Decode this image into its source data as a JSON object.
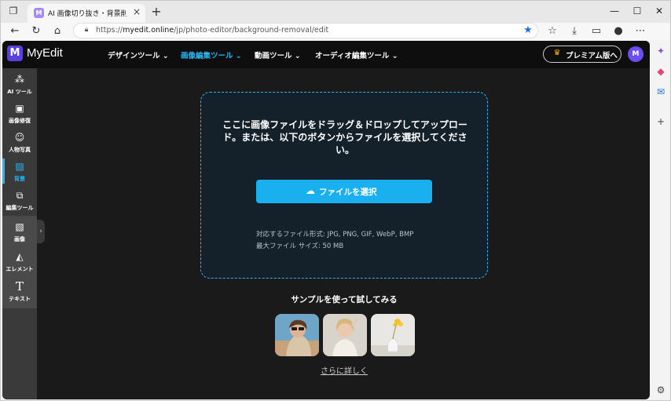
{
  "browser": {
    "tab_title": "AI 画像切り抜き・背景削除サイト | M",
    "favicon_letter": "M",
    "url_prefix": "https://",
    "url_host": "myedit.online",
    "url_path": "/jp/photo-editor/background-removal/edit"
  },
  "header": {
    "logo_mark": "M",
    "logo_text": "MyEdit",
    "menus": [
      {
        "label": "デザインツール ⌄"
      },
      {
        "label": "画像編集ツール ⌄"
      },
      {
        "label": "動画ツール ⌄"
      },
      {
        "label": "オーディオ編集ツール ⌄"
      }
    ],
    "premium_label": "プレミアム版へ",
    "avatar_letter": "M"
  },
  "sidebar": {
    "items": [
      {
        "label": "AI ツール",
        "icon": "magic-wand-icon"
      },
      {
        "label": "画像修復",
        "icon": "image-repair-icon"
      },
      {
        "label": "人物写真",
        "icon": "portrait-icon"
      },
      {
        "label": "背景",
        "icon": "background-icon"
      },
      {
        "label": "編集ツール",
        "icon": "edit-tools-icon"
      },
      {
        "label": "画像",
        "icon": "image-icon"
      },
      {
        "label": "エレメント",
        "icon": "elements-icon"
      },
      {
        "label": "テキスト",
        "icon": "text-icon"
      }
    ],
    "active_index": 3
  },
  "dropzone": {
    "instruction": "ここに画像ファイルをドラッグ＆ドロップしてアップロード。または、以下のボタンからファイルを選択してください。",
    "button_label": "ファイルを選択",
    "formats": "対応するファイル形式: JPG, PNG, GIF, WebP, BMP",
    "max_size": "最大ファイル サイズ: 50 MB"
  },
  "samples": {
    "title": "サンプルを使って試してみる",
    "more_link": "さらに詳しく"
  },
  "colors": {
    "accent": "#29b6f6",
    "button": "#1ab0f0",
    "brand": "#5b3fe0"
  }
}
